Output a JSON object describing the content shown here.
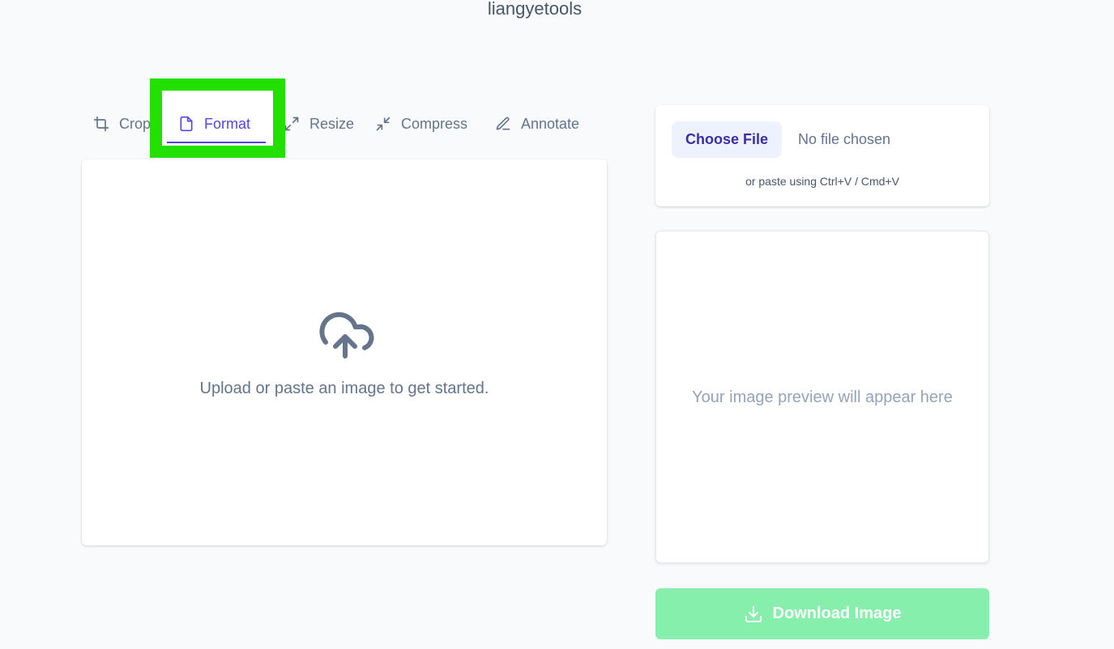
{
  "app": {
    "title": "liangyetools"
  },
  "tabs": [
    {
      "label": "Crop",
      "icon": "crop-icon",
      "active": false
    },
    {
      "label": "Format",
      "icon": "file-icon",
      "active": true
    },
    {
      "label": "Resize",
      "icon": "resize-icon",
      "active": false
    },
    {
      "label": "Compress",
      "icon": "compress-icon",
      "active": false
    },
    {
      "label": "Annotate",
      "icon": "pencil-icon",
      "active": false
    }
  ],
  "upload": {
    "icon": "cloud-upload-icon",
    "message": "Upload or paste an image to get started."
  },
  "file_input": {
    "button_label": "Choose File",
    "status": "No file chosen",
    "hint": "or paste using Ctrl+V / Cmd+V"
  },
  "preview": {
    "placeholder": "Your image preview will appear here"
  },
  "download": {
    "label": "Download Image",
    "icon": "download-icon",
    "enabled": false
  },
  "colors": {
    "accent": "#4f46e5",
    "highlight": "#22e000",
    "download_bg": "#86efac",
    "page_bg": "#f8fafc"
  }
}
